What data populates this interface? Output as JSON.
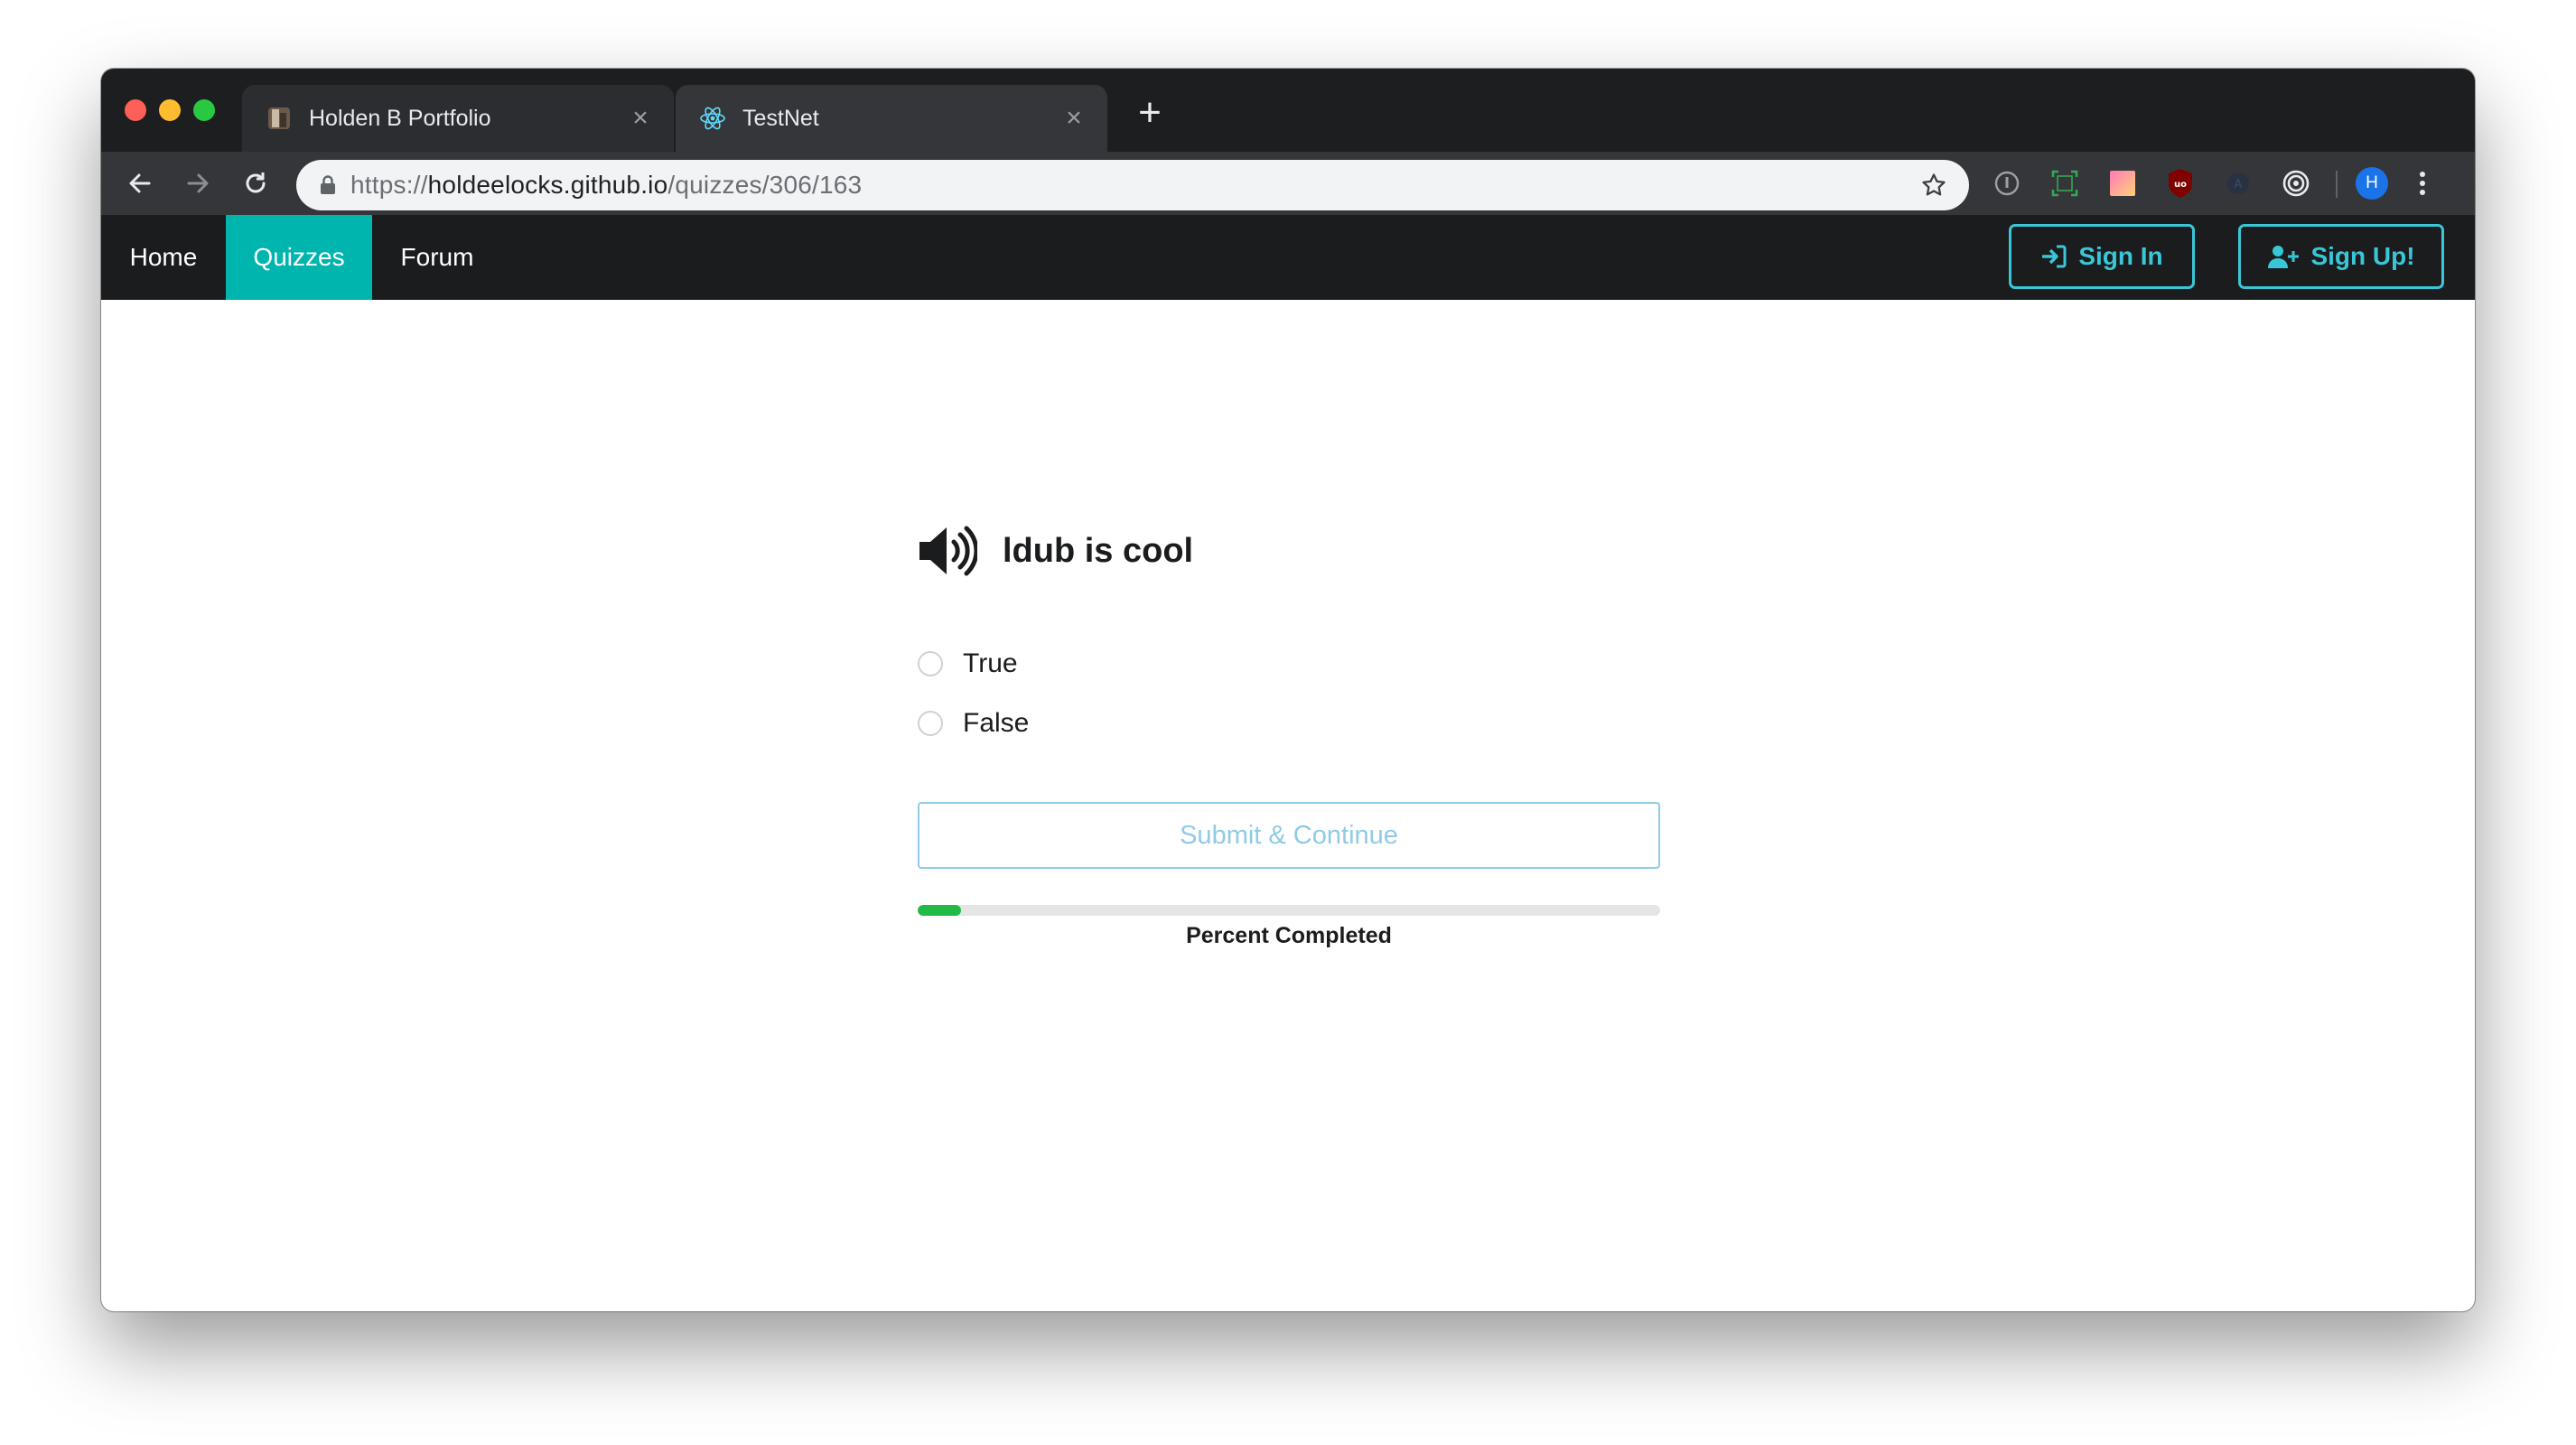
{
  "browser": {
    "tabs": [
      {
        "title": "Holden B Portfolio",
        "active": false,
        "favicon": "portfolio-photo-icon"
      },
      {
        "title": "TestNet",
        "active": true,
        "favicon": "react-atom-icon"
      }
    ],
    "url": {
      "scheme": "https://",
      "host": "holdeelocks.github.io",
      "path": "/quizzes/306/163"
    },
    "profile_initial": "H"
  },
  "nav": {
    "items": [
      {
        "label": "Home",
        "active": false
      },
      {
        "label": "Quizzes",
        "active": true
      },
      {
        "label": "Forum",
        "active": false
      }
    ],
    "sign_in": "Sign In",
    "sign_up": "Sign Up!"
  },
  "quiz": {
    "question": "ldub is cool",
    "options": [
      "True",
      "False"
    ],
    "submit_label": "Submit & Continue",
    "progress_fraction": 0.058,
    "progress_label": "Percent Completed"
  },
  "colors": {
    "accent_teal": "#00b5ad",
    "auth_outline": "#39c7d8",
    "progress_green": "#21ba45",
    "submit_blue": "#8fcbe5"
  }
}
